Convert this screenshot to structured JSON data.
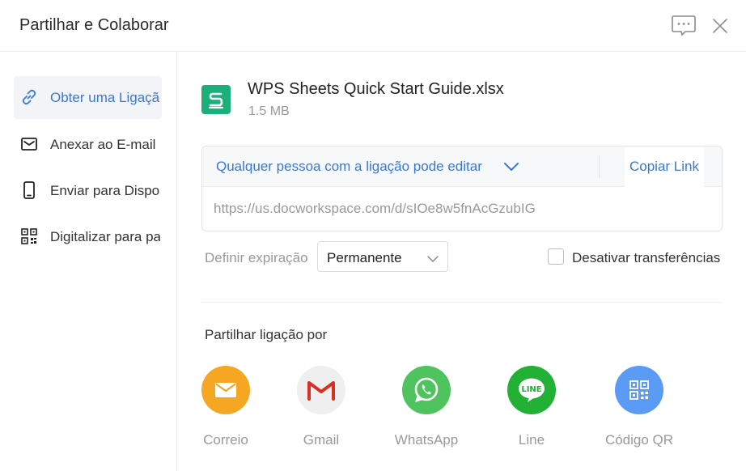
{
  "header": {
    "title": "Partilhar e Colaborar",
    "feedback_icon": "chat-bubble-icon",
    "close_icon": "close-icon"
  },
  "sidebar": {
    "items": [
      {
        "label": "Obter uma Ligação",
        "icon": "link-icon",
        "active": true
      },
      {
        "label": "Anexar ao E-mail",
        "icon": "mail-icon",
        "active": false
      },
      {
        "label": "Enviar para Dispositivo",
        "icon": "phone-icon",
        "active": false
      },
      {
        "label": "Digitalizar para partilhar",
        "icon": "qr-code-icon",
        "active": false
      }
    ]
  },
  "file": {
    "name": "WPS Sheets Quick Start Guide.xlsx",
    "size": "1.5 MB",
    "icon_letter": "S",
    "icon_color": "#1bb07a"
  },
  "link": {
    "permission": "Qualquer pessoa com a ligação pode editar",
    "copy_label": "Copiar Link",
    "url": "https://us.docworkspace.com/d/sIOe8w5fnAcGzubIG"
  },
  "expiration": {
    "label": "Definir expiração",
    "value": "Permanente"
  },
  "disable_downloads": {
    "label": "Desativar transferências",
    "checked": false
  },
  "share": {
    "label": "Partilhar ligação por",
    "options": [
      {
        "label": "Correio",
        "icon": "mail-icon",
        "color": "#f5a623"
      },
      {
        "label": "Gmail",
        "icon": "gmail-icon",
        "color": "#efefef"
      },
      {
        "label": "WhatsApp",
        "icon": "whatsapp-icon",
        "color": "#4fc35d"
      },
      {
        "label": "Line",
        "icon": "line-icon",
        "color": "#22b035"
      },
      {
        "label": "Código QR",
        "icon": "qr-code-icon",
        "color": "#5b9bf5"
      }
    ]
  },
  "colors": {
    "accent": "#3a77d8",
    "muted_text": "#999999"
  }
}
